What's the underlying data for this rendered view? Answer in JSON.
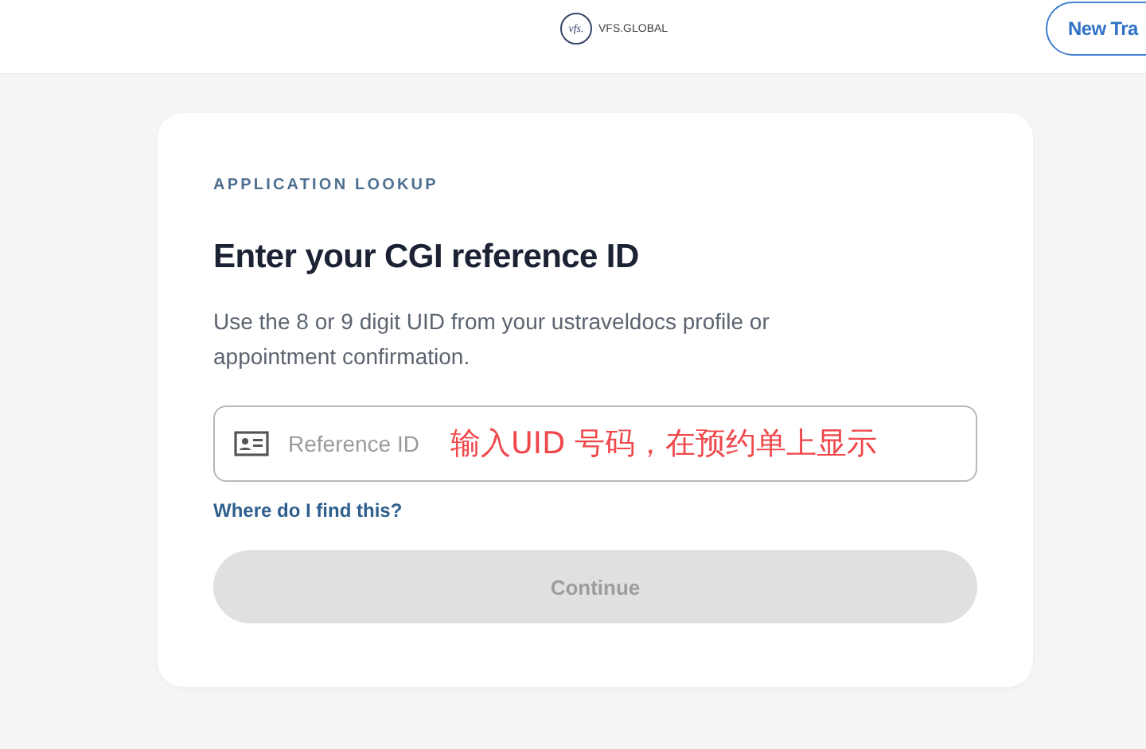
{
  "header": {
    "logo_text": "VFS.GLOBAL",
    "logo_mark": "vfs.",
    "action_button": "New Tra"
  },
  "card": {
    "eyebrow": "APPLICATION LOOKUP",
    "title": "Enter your CGI reference ID",
    "description": "Use the 8 or 9 digit UID from your ustraveldocs profile or appointment confirmation.",
    "field": {
      "placeholder": "Reference ID",
      "annotation": "输入UID 号码，在预约单上显示"
    },
    "help_link": "Where do I find this?",
    "submit": {
      "label": "Continue",
      "disabled": true
    }
  }
}
